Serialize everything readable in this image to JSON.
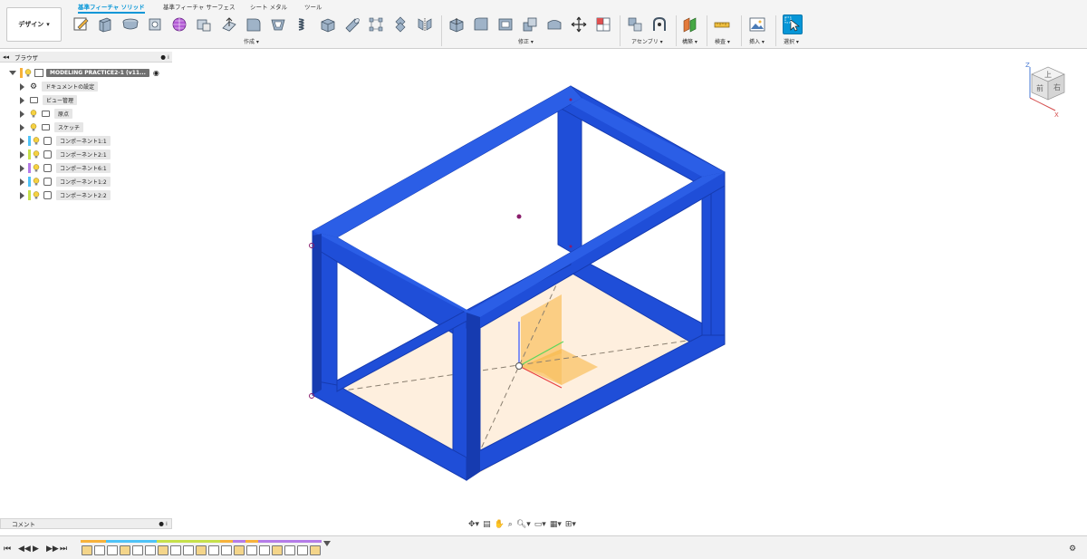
{
  "toolbar": {
    "workspace_label": "デザイン",
    "tabs": [
      "基準フィーチャ ソリッド",
      "基準フィーチャ サーフェス",
      "シート メタル",
      "ツール"
    ],
    "groups": {
      "create": "作成 ▾",
      "modify": "修正 ▾",
      "assemble": "アセンブリ ▾",
      "construct": "構築 ▾",
      "inspect": "検査 ▾",
      "insert": "挿入 ▾",
      "select": "選択 ▾"
    },
    "icons": [
      "new-sketch-icon",
      "extrude-icon",
      "revolve-icon",
      "hole-icon",
      "form-icon",
      "box-icon",
      "cylinder-icon",
      "sphere-icon",
      "torus-icon",
      "coil-icon",
      "pipe-icon",
      "press-pull-icon",
      "fillet-icon",
      "shell-icon",
      "combine-icon",
      "move-icon",
      "align-icon",
      "joint-icon",
      "as-built-joint-icon",
      "offset-plane-icon",
      "measure-icon",
      "insert-image-icon",
      "select-icon"
    ]
  },
  "browser": {
    "title": "ブラウザ",
    "root_label": "MODELING PRACTICE2-1 (v11...",
    "items": [
      {
        "label": "ドキュメントの設定",
        "type": "settings"
      },
      {
        "label": "ビュー管理",
        "type": "folder"
      },
      {
        "label": "原点",
        "type": "folder",
        "bulb": true
      },
      {
        "label": "スケッチ",
        "type": "folder",
        "bulb": true
      },
      {
        "label": "コンポーネント1:1",
        "type": "component",
        "color": "#4fc3f7"
      },
      {
        "label": "コンポーネント2:1",
        "type": "component",
        "color": "#c6e04a"
      },
      {
        "label": "コンポーネント6:1",
        "type": "component",
        "color": "#b47be8"
      },
      {
        "label": "コンポーネント1:2",
        "type": "component",
        "color": "#4fc3f7"
      },
      {
        "label": "コンポーネント2:2",
        "type": "component",
        "color": "#c6e04a"
      }
    ]
  },
  "comments": {
    "label": "コメント"
  },
  "viewcube": {
    "top": "上",
    "front": "前",
    "right": "右",
    "z_axis": "Z",
    "x_axis": "X"
  },
  "colors": {
    "model_blue": "#1f4ed8",
    "model_blue_dark": "#163bb0",
    "accent": "#0696d7",
    "origin_plane": "#f7b23b"
  }
}
